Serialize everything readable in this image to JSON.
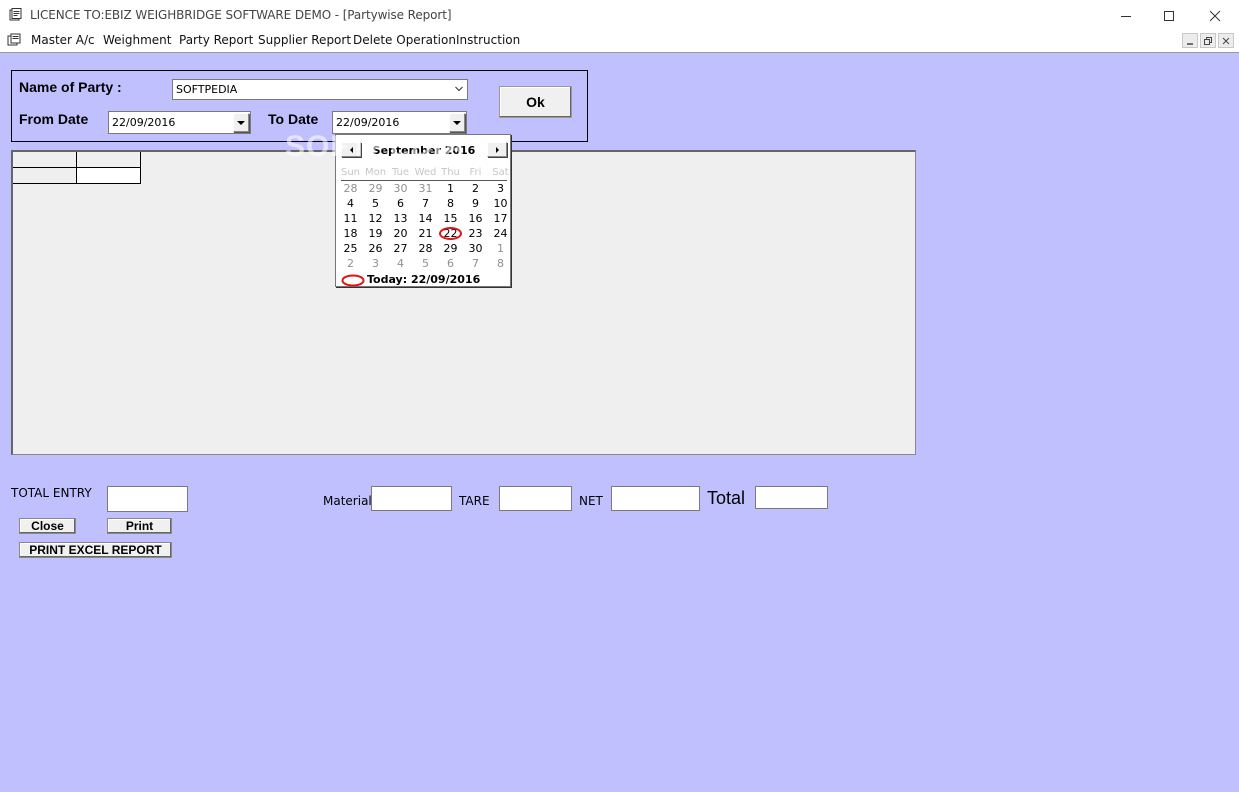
{
  "window": {
    "title": "LICENCE TO:EBIZ WEIGHBRIDGE SOFTWARE DEMO - [Partywise Report]"
  },
  "menu": {
    "items": [
      "Master A/c",
      "Weighment",
      "Party Report",
      "Supplier Report",
      "Delete Operation",
      "Instruction"
    ]
  },
  "filter": {
    "party_label": "Name of Party :",
    "party_value": "SOFTPEDIA",
    "from_label": "From Date",
    "from_value": "22/09/2016",
    "to_label": "To Date",
    "to_value": "22/09/2016",
    "ok_label": "Ok"
  },
  "calendar": {
    "month_title": "September 2016",
    "weekdays": [
      "Sun",
      "Mon",
      "Tue",
      "Wed",
      "Thu",
      "Fri",
      "Sat"
    ],
    "weeks": [
      [
        "28",
        "29",
        "30",
        "31",
        "1",
        "2",
        "3"
      ],
      [
        "4",
        "5",
        "6",
        "7",
        "8",
        "9",
        "10"
      ],
      [
        "11",
        "12",
        "13",
        "14",
        "15",
        "16",
        "17"
      ],
      [
        "18",
        "19",
        "20",
        "21",
        "22",
        "23",
        "24"
      ],
      [
        "25",
        "26",
        "27",
        "28",
        "29",
        "30",
        "1"
      ],
      [
        "2",
        "3",
        "4",
        "5",
        "6",
        "7",
        "8"
      ]
    ],
    "selected_day": "22",
    "today_text": "Today: 22/09/2016"
  },
  "watermark": "SOFTPEDIA",
  "totals": {
    "total_entry_label": "TOTAL ENTRY",
    "material_label": "Material",
    "tare_label": "TARE",
    "net_label": "NET",
    "total_label": "Total"
  },
  "buttons": {
    "close": "Close",
    "print": "Print",
    "excel": "PRINT EXCEL REPORT"
  },
  "colors": {
    "client_background": "#c0c0ff",
    "grid_background": "#efefef",
    "today_ring": "#e01515"
  }
}
